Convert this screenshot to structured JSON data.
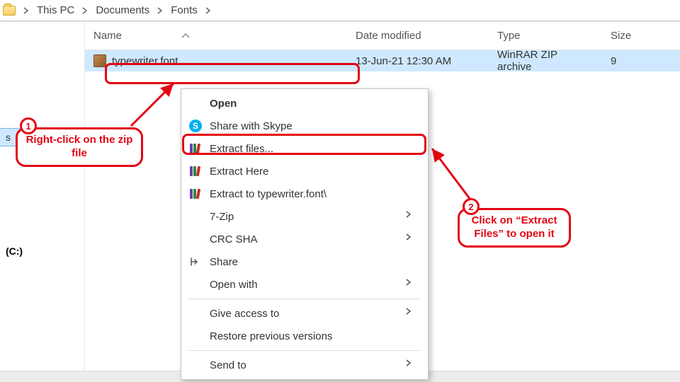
{
  "breadcrumb": {
    "root": "This PC",
    "path": [
      "Documents",
      "Fonts"
    ]
  },
  "columns": {
    "name": "Name",
    "modified": "Date modified",
    "type": "Type",
    "size": "Size"
  },
  "row": {
    "name": "typewriter.font",
    "modified": "13-Jun-21 12:30 AM",
    "type": "WinRAR ZIP archive",
    "size": "9"
  },
  "sidebar": {
    "sel": "s",
    "drive": "(C:)"
  },
  "ctx": {
    "open": "Open",
    "skype": "Share with Skype",
    "extract_files": "Extract files...",
    "extract_here": "Extract Here",
    "extract_to": "Extract to typewriter.font\\",
    "seven_zip": "7-Zip",
    "crc": "CRC SHA",
    "share": "Share",
    "open_with": "Open with",
    "give_access": "Give access to",
    "restore": "Restore previous versions",
    "send_to": "Send to"
  },
  "annotations": {
    "n1": "1",
    "n2": "2",
    "t1": "Right-click on the zip file",
    "t2": "Click on “Extract Files” to open it"
  }
}
